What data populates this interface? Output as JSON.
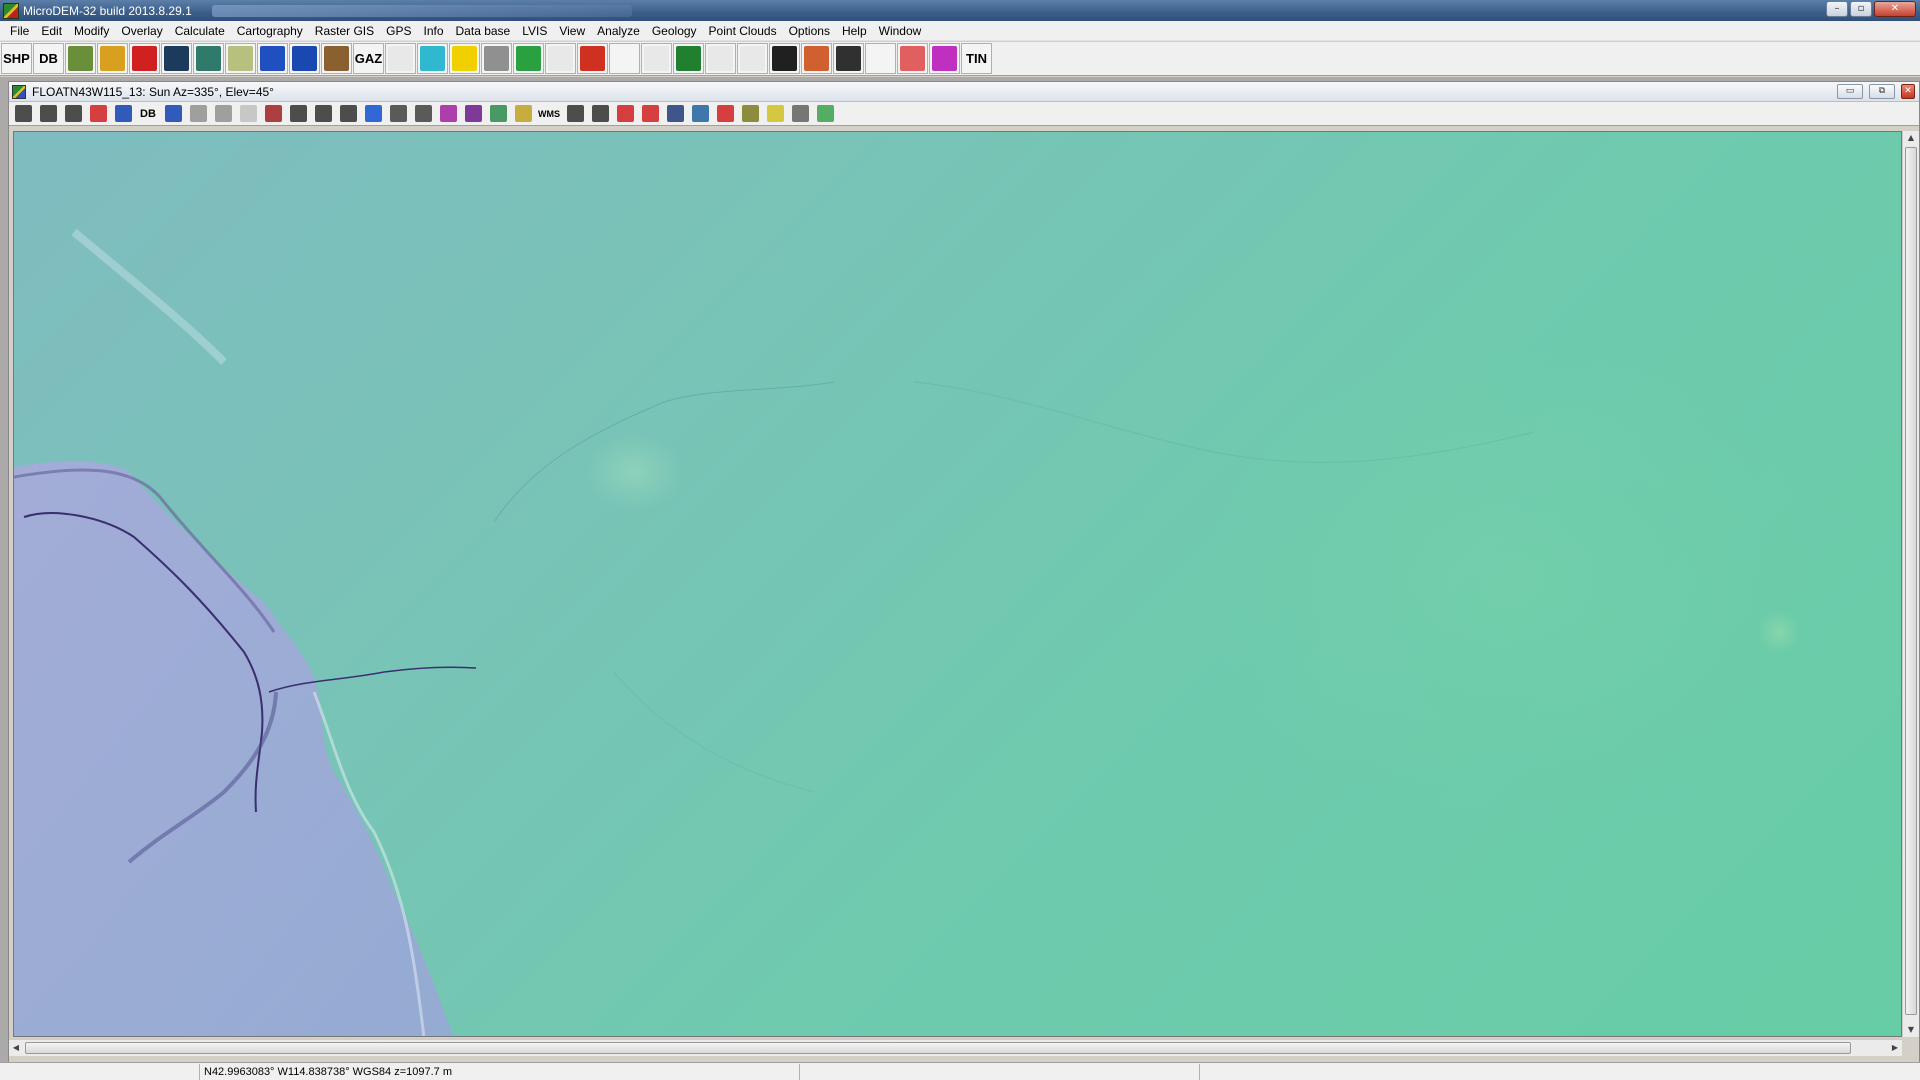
{
  "app": {
    "title": "MicroDEM-32 build 2013.8.29.1",
    "window_controls": [
      "–",
      "▫",
      "✕"
    ]
  },
  "menu": [
    "File",
    "Edit",
    "Modify",
    "Overlay",
    "Calculate",
    "Cartography",
    "Raster GIS",
    "GPS",
    "Info",
    "Data base",
    "LVIS",
    "View",
    "Analyze",
    "Geology",
    "Point Clouds",
    "Options",
    "Help",
    "Window"
  ],
  "main_toolbar": {
    "shp_label": "SHP",
    "db_label": "DB",
    "gaz_label": "GAZ",
    "tin_label": "TIN",
    "icons": [
      "layers-icon",
      "terrain-color-icon",
      "red-map-icon",
      "dark-dem-icon",
      "cube-icon",
      "scan-map-icon",
      "globe-blue-icon",
      "globe-world-icon",
      "owl-icon"
    ],
    "icons2": [
      "in-out-icon",
      "utm-icon",
      "sun-icon",
      "scan-icon",
      "los-icon",
      "profile-icon",
      "geology-color-icon",
      "grid-mesh-icon",
      "perspective-icon",
      "house-icon",
      "fly-icon",
      "fly-through-icon",
      "opengl-icon",
      "3d-block-icon",
      "wireframe-globe-icon",
      "triangle-icon",
      "terrain-text-icon",
      "striped-grid-icon"
    ],
    "colors": {
      "layers-icon": "#6a8f3a",
      "terrain-color-icon": "#d9a020",
      "red-map-icon": "#d02020",
      "dark-dem-icon": "#1c3a5c",
      "cube-icon": "#2f7a6a",
      "scan-map-icon": "#b8c080",
      "globe-blue-icon": "#2050c0",
      "globe-world-icon": "#1848b0",
      "owl-icon": "#8a6030",
      "in-out-icon": "#e8e8e8",
      "utm-icon": "#30b8d0",
      "sun-icon": "#f0d000",
      "scan-icon": "#909090",
      "los-icon": "#2aa040",
      "profile-icon": "#e8e8e8",
      "geology-color-icon": "#d03020",
      "grid-mesh-icon": "#f4f4f4",
      "perspective-icon": "#e8e8e8",
      "house-icon": "#208030",
      "fly-icon": "#e8e8e8",
      "fly-through-icon": "#e8e8e8",
      "opengl-icon": "#202020",
      "3d-block-icon": "#d06030",
      "wireframe-globe-icon": "#303030",
      "triangle-icon": "#f4f4f4",
      "terrain-text-icon": "#e06060",
      "striped-grid-icon": "#c030c0"
    }
  },
  "map_window": {
    "title": "FLOATN43W115_13: Sun Az=335°, Elev=45°",
    "toolbar_db_label": "DB",
    "toolbar_wms_label": "WMS",
    "toolbar_icons": [
      "print-icon",
      "copy-icon",
      "save-icon",
      "refresh-icon",
      "select-icon",
      "table-icon",
      "zoom-box-icon",
      "pan-icon",
      "crosshair-icon",
      "subset-icon",
      "zoom-in-icon",
      "zoom-all-icon",
      "zoom-out-icon",
      "redraw-icon",
      "measure-icon",
      "line-icon",
      "purple-blob-icon",
      "mountain-icon",
      "color-dem-icon",
      "legend-icon",
      "target-icon",
      "grid-icon",
      "overlay-icon",
      "record-icon",
      "landsat-icon",
      "oval-icon",
      "help-icon",
      "gps-icon",
      "scatter-icon",
      "bars-icon",
      "green-dots-icon"
    ],
    "toolbar_colors": {
      "print-icon": "#303030",
      "copy-icon": "#303030",
      "save-icon": "#303030",
      "refresh-icon": "#d02020",
      "select-icon": "#1040b0",
      "table-icon": "#1040b0",
      "zoom-box-icon": "#909090",
      "pan-icon": "#909090",
      "crosshair-icon": "#c0c0c0",
      "subset-icon": "#a02020",
      "zoom-in-icon": "#303030",
      "zoom-all-icon": "#303030",
      "zoom-out-icon": "#303030",
      "redraw-icon": "#1050d0",
      "measure-icon": "#404040",
      "line-icon": "#404040",
      "purple-blob-icon": "#a020a0",
      "mountain-icon": "#6a1a8a",
      "color-dem-icon": "#2a8a4a",
      "legend-icon": "#c0a020",
      "target-icon": "#303030",
      "grid-icon": "#303030",
      "overlay-icon": "#d02020",
      "record-icon": "#d02020",
      "landsat-icon": "#203a7a",
      "oval-icon": "#2060a0",
      "help-icon": "#d02020",
      "gps-icon": "#7a7a20",
      "scatter-icon": "#d0c020",
      "bars-icon": "#606060",
      "green-dots-icon": "#3aa04a"
    },
    "window_controls": [
      "▭",
      "⧉",
      "✕"
    ]
  },
  "status": {
    "coords": "N42.9963083° W114.838738°   WGS84 z=1097.7 m"
  }
}
